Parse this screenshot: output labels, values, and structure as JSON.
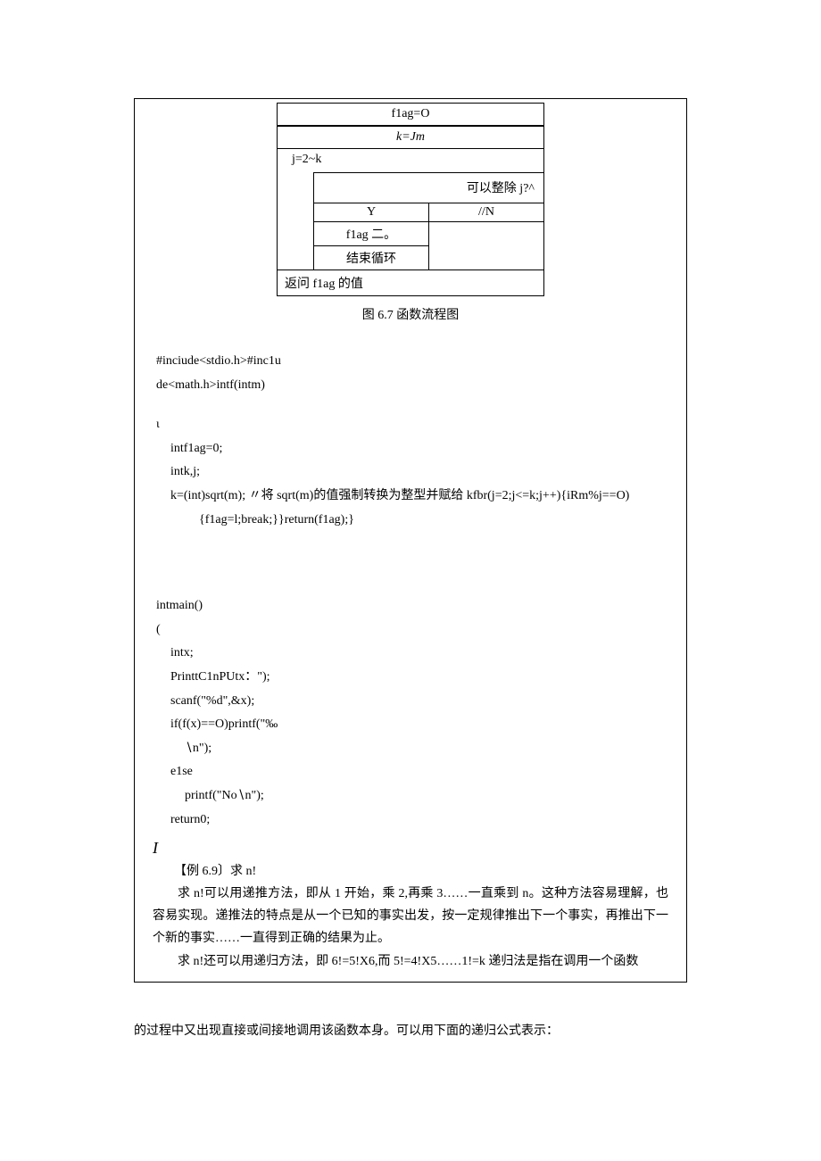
{
  "flowchart": {
    "r1": "f1ag=O",
    "r2": "k=Jm",
    "loop_head": "j=2~k",
    "cond": "可以整除 j?^",
    "y": "Y",
    "n": "//N",
    "flag_set": "f1ag 二。",
    "break": "结束循环",
    "ret": "返问 f1ag 的值"
  },
  "caption": "图 6.7 函数流程图",
  "code1": {
    "l1": "#inciude<stdio.h>#inc1u",
    "l2": "de<math.h>intf(intm)",
    "l3": "ι",
    "l4": "intf1ag=0;",
    "l5": "intk,j;",
    "l6": "k=(int)sqrt(m); 〃将 sqrt(m)的值强制转换为整型并赋给 kfbr(j=2;j<=k;j++){iRm%j==O)",
    "l7": "{f1ag=l;break;}}return(f1ag);}"
  },
  "code2": {
    "l1": "intmain()",
    "l2": "(",
    "l3": "intx;",
    "l4": "PrinttC1nPUtx：\");",
    "l5": "scanf(\"%d\",&x);",
    "l6": "if(f(x)==O)printf(\"‰",
    "l7": "∖n\");",
    "l8": "e1se",
    "l9": "printf(\"No∖n\");",
    "l10": "return0;"
  },
  "big_i": "I",
  "example": "【例 6.9〕求 n!",
  "para1": "求 n!可以用递推方法，即从 1 开始，乘 2,再乘 3……一直乘到 n。这种方法容易理解，也容易实现。递推法的特点是从一个已知的事实出发，按一定规律推出下一个事实，再推出下一个新的事实……一直得到正确的结果为止。",
  "para2": "求 n!还可以用递归方法，即 6!=5!X6,而 5!=4!X5……1!=k 递归法是指在调用一个函数",
  "footer": "的过程中又出现直接或间接地调用该函数本身。可以用下面的递归公式表示："
}
